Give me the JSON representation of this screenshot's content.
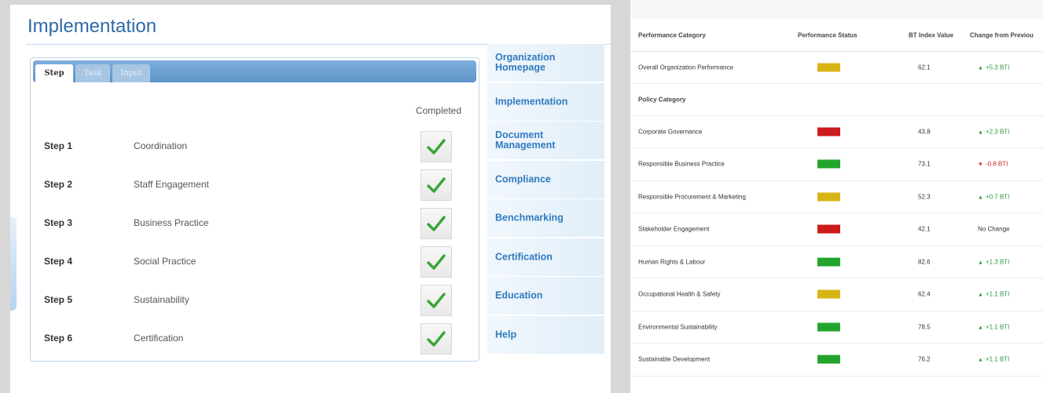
{
  "implementation": {
    "title": "Implementation",
    "tabs": [
      "Step",
      "Task",
      "Input"
    ],
    "completed_header": "Completed",
    "steps": [
      {
        "num": "Step 1",
        "name": "Coordination",
        "completed": true
      },
      {
        "num": "Step 2",
        "name": "Staff Engagement",
        "completed": true
      },
      {
        "num": "Step 3",
        "name": "Business Practice",
        "completed": true
      },
      {
        "num": "Step 4",
        "name": "Social Practice",
        "completed": true
      },
      {
        "num": "Step 5",
        "name": "Sustainability",
        "completed": true
      },
      {
        "num": "Step 6",
        "name": "Certification",
        "completed": true
      }
    ],
    "check_color": "#3aa535",
    "nav": [
      "Organization Homepage",
      "Implementation",
      "Document Management",
      "Compliance",
      "Benchmarking",
      "Certification",
      "Education",
      "Help"
    ]
  },
  "performance": {
    "headers": {
      "category": "Performance Category",
      "status": "Performance Status",
      "index": "BT Index Value",
      "change": "Change from Previou"
    },
    "status_colors": {
      "red": "#cc1b1b",
      "yellow": "#d8b515",
      "green": "#23a52d"
    },
    "overall": {
      "category": "Overall Organization Performance",
      "status": "yellow",
      "index": "62.1",
      "change": "+5.3 BTI",
      "direction": "up"
    },
    "policy_label": "Policy Category",
    "rows": [
      {
        "category": "Corporate Governance",
        "status": "red",
        "index": "43.8",
        "change": "+2.3 BTI",
        "direction": "up"
      },
      {
        "category": "Responsible Business Practice",
        "status": "green",
        "index": "73.1",
        "change": "-0.8 BTI",
        "direction": "down"
      },
      {
        "category": "Responsible Procurement & Marketing",
        "status": "yellow",
        "index": "52.3",
        "change": "+0.7 BTI",
        "direction": "up"
      },
      {
        "category": "Stakeholder Engagement",
        "status": "red",
        "index": "42.1",
        "change": "No Change",
        "direction": "none"
      },
      {
        "category": "Human Rights & Labour",
        "status": "green",
        "index": "82.6",
        "change": "+1.3 BTI",
        "direction": "up"
      },
      {
        "category": "Occupational Health & Safety",
        "status": "yellow",
        "index": "62.4",
        "change": "+1.1 BTI",
        "direction": "up"
      },
      {
        "category": "Environmental Sustainability",
        "status": "green",
        "index": "78.5",
        "change": "+1.1 BTI",
        "direction": "up"
      },
      {
        "category": "Sustainable Development",
        "status": "green",
        "index": "76.2",
        "change": "+1.1 BTI",
        "direction": "up"
      }
    ]
  }
}
